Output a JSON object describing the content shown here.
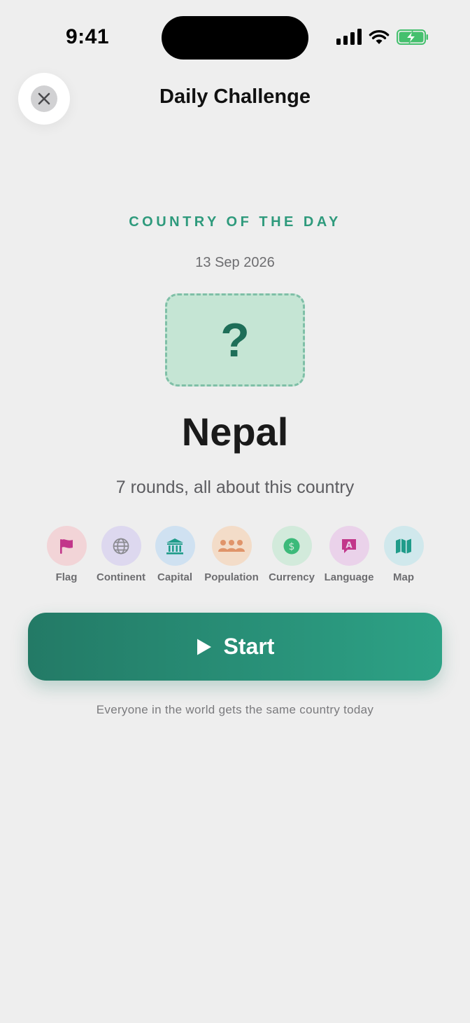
{
  "status_bar": {
    "time": "9:41"
  },
  "header": {
    "title": "Daily Challenge"
  },
  "challenge": {
    "eyebrow": "COUNTRY OF THE DAY",
    "date": "13 Sep 2026",
    "flag_placeholder": "?",
    "country": "Nepal",
    "subtitle": "7 rounds, all about this country"
  },
  "categories": [
    {
      "label": "Flag",
      "icon": "flag-icon",
      "bg": "#f2d4d7",
      "color": "#c2368a"
    },
    {
      "label": "Continent",
      "icon": "globe-icon",
      "bg": "#ddd8ef",
      "color": "#8a8a90"
    },
    {
      "label": "Capital",
      "icon": "building-columns-icon",
      "bg": "#cfe1f1",
      "color": "#1f9c8a"
    },
    {
      "label": "Population",
      "icon": "people-icon",
      "bg": "#f3dcc8",
      "color": "#e0946a"
    },
    {
      "label": "Currency",
      "icon": "coin-icon",
      "bg": "#d2eadb",
      "color": "#3cba7a"
    },
    {
      "label": "Language",
      "icon": "speech-bubble-icon",
      "bg": "#ead2ea",
      "color": "#c2368a"
    },
    {
      "label": "Map",
      "icon": "map-icon",
      "bg": "#d0e8ec",
      "color": "#1f9c8a"
    }
  ],
  "start_button": {
    "label": "Start"
  },
  "footnote": "Everyone in the world gets the same country today",
  "colors": {
    "accent": "#2e9a7c",
    "button_start": "#237a66",
    "button_end": "#2da286",
    "background": "#eeeeee"
  }
}
